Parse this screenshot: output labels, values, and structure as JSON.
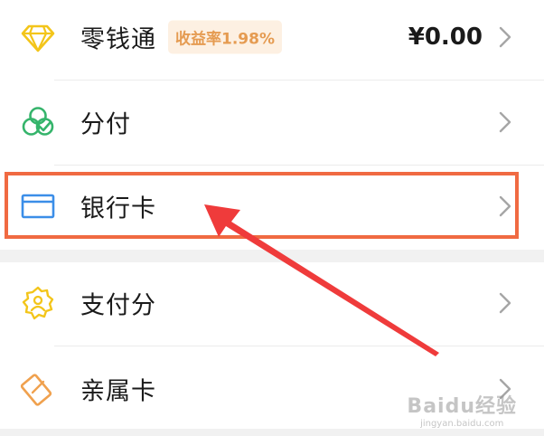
{
  "rows": [
    {
      "label": "零钱通",
      "badge": "收益率1.98%",
      "amount": "¥0.00",
      "icon": "diamond-icon",
      "icon_color": "#f3c51a"
    },
    {
      "label": "分付",
      "icon": "fenfu-icon",
      "icon_color": "#35b46b"
    },
    {
      "label": "银行卡",
      "icon": "bank-card-icon",
      "icon_color": "#3b8ee8"
    },
    {
      "label": "支付分",
      "icon": "payscore-icon",
      "icon_color": "#f3c51a"
    },
    {
      "label": "亲属卡",
      "icon": "family-card-icon",
      "icon_color": "#f0a14e"
    }
  ],
  "annotation": {
    "color": "#f06a42",
    "arrow_color": "#ef3b3b"
  },
  "watermark": {
    "main": "Baidu经验",
    "sub": "jingyan.baidu.com"
  }
}
